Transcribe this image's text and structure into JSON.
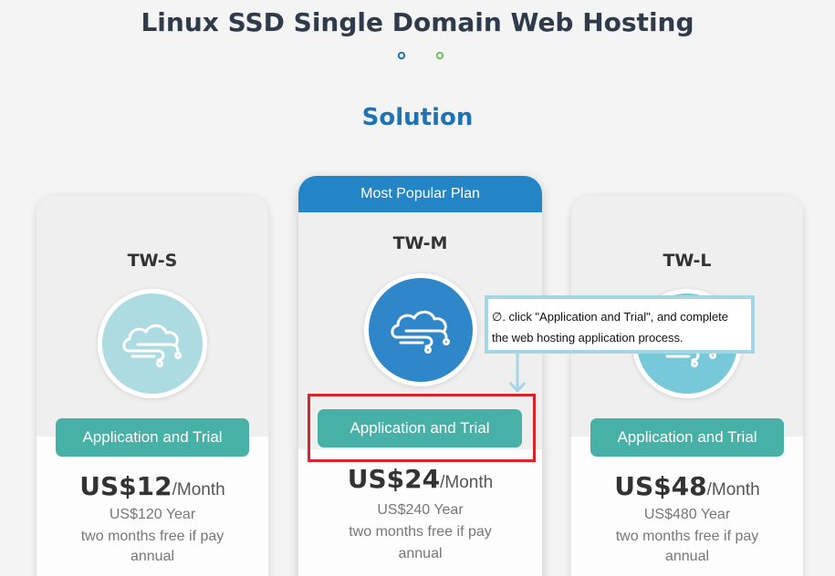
{
  "page": {
    "title": "Linux SSD Single Domain Web Hosting",
    "section_title": "Solution"
  },
  "colors": {
    "title": "#2f3a4a",
    "section_title": "#1e73b3",
    "popular_band": "#2384c6",
    "button": "#47b0a7",
    "highlight": "#d9232a",
    "callout_border": "#a5d6e6"
  },
  "plans": [
    {
      "name": "TW-S",
      "icon": "cloud-icon",
      "icon_bg": "#acdbe2",
      "button_label": "Application and Trial",
      "price": "US$12",
      "per": "/Month",
      "yearly": "US$120 Year",
      "promo_line1": "two months free if pay",
      "promo_line2": "annual"
    },
    {
      "name": "TW-M",
      "badge": "Most Popular Plan",
      "icon": "cloud-icon",
      "icon_bg": "#2f86c8",
      "button_label": "Application and Trial",
      "price": "US$24",
      "per": "/Month",
      "yearly": "US$240 Year",
      "promo_line1": "two months free if pay",
      "promo_line2": "annual"
    },
    {
      "name": "TW-L",
      "icon": "cloud-icon",
      "icon_bg": "#77c8d8",
      "button_label": "Application and Trial",
      "price": "US$48",
      "per": "/Month",
      "yearly": "US$480 Year",
      "promo_line1": "two months free if pay",
      "promo_line2": "annual"
    }
  ],
  "callout": {
    "line1": "∅. click \"Application and Trial\", and complete",
    "line2": "the web hosting application process."
  }
}
